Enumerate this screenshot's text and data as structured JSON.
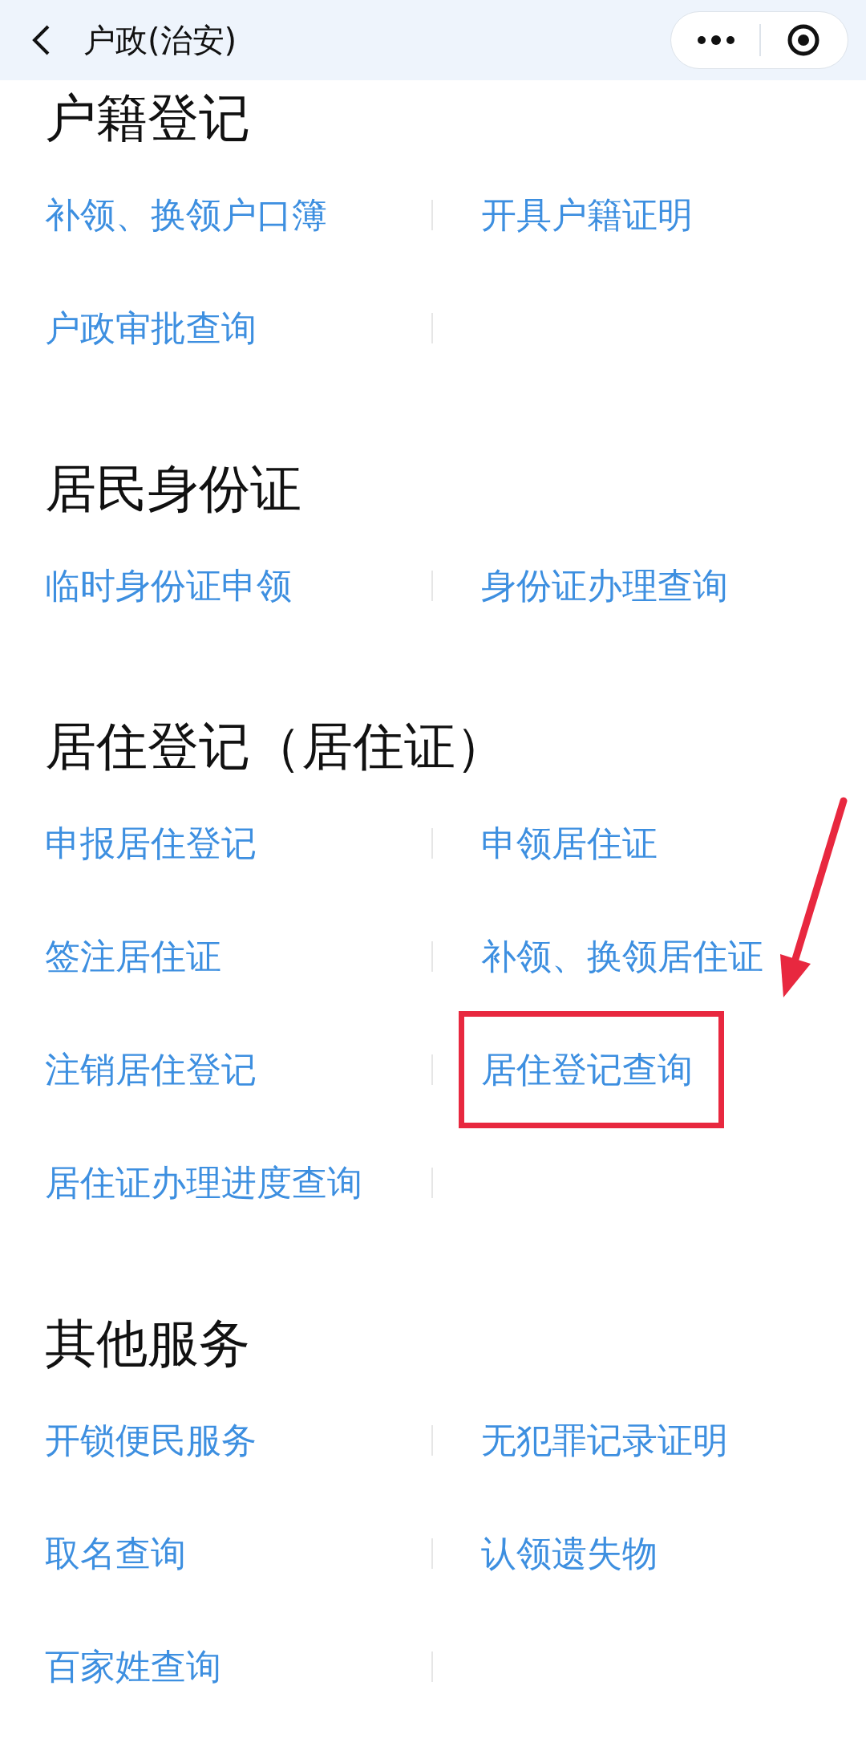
{
  "header": {
    "title": "户政(治安)"
  },
  "sections": [
    {
      "title": "户籍登记",
      "items": [
        {
          "label": "补领、换领户口簿",
          "highlighted": false
        },
        {
          "label": "开具户籍证明",
          "highlighted": false
        },
        {
          "label": "户政审批查询",
          "highlighted": false
        }
      ]
    },
    {
      "title": "居民身份证",
      "items": [
        {
          "label": "临时身份证申领",
          "highlighted": false
        },
        {
          "label": "身份证办理查询",
          "highlighted": false
        }
      ]
    },
    {
      "title": "居住登记（居住证）",
      "items": [
        {
          "label": "申报居住登记",
          "highlighted": false
        },
        {
          "label": "申领居住证",
          "highlighted": false
        },
        {
          "label": "签注居住证",
          "highlighted": false
        },
        {
          "label": "补领、换领居住证",
          "highlighted": false
        },
        {
          "label": "注销居住登记",
          "highlighted": false
        },
        {
          "label": "居住登记查询",
          "highlighted": true
        },
        {
          "label": "居住证办理进度查询",
          "highlighted": false
        }
      ]
    },
    {
      "title": "其他服务",
      "items": [
        {
          "label": "开锁便民服务",
          "highlighted": false
        },
        {
          "label": "无犯罪记录证明",
          "highlighted": false
        },
        {
          "label": "取名查询",
          "highlighted": false
        },
        {
          "label": "认领遗失物",
          "highlighted": false
        },
        {
          "label": "百家姓查询",
          "highlighted": false
        }
      ]
    }
  ]
}
